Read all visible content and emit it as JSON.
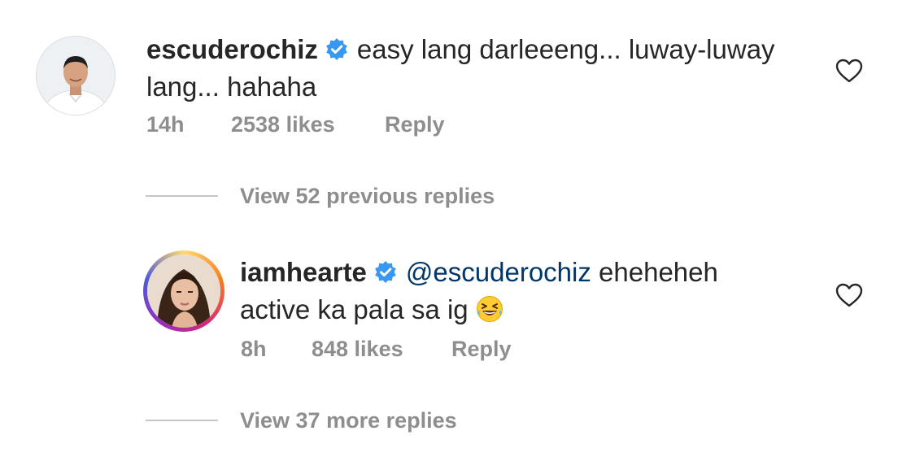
{
  "comments": [
    {
      "username": "escuderochiz",
      "text_line1": "easy lang darleeeng... luway-luway",
      "text_line2": "lang... hahaha",
      "time": "14h",
      "likes": "2538 likes",
      "reply_label": "Reply",
      "view_replies": "View 52 previous replies"
    },
    {
      "username": "iamhearte",
      "mention": "@escuderochiz",
      "text_line1": " eheheheh",
      "text_line2": "active ka pala sa ig",
      "time": "8h",
      "likes": "848 likes",
      "reply_label": "Reply",
      "view_replies": "View 37 more replies"
    }
  ],
  "icons": {
    "verified": "verified-badge-icon",
    "like": "heart-outline-icon",
    "emoji": "grinning-squinting-face-emoji"
  },
  "colors": {
    "verified_blue": "#3897f0",
    "meta_gray": "#8e8e8e",
    "mention_blue": "#00376b"
  }
}
